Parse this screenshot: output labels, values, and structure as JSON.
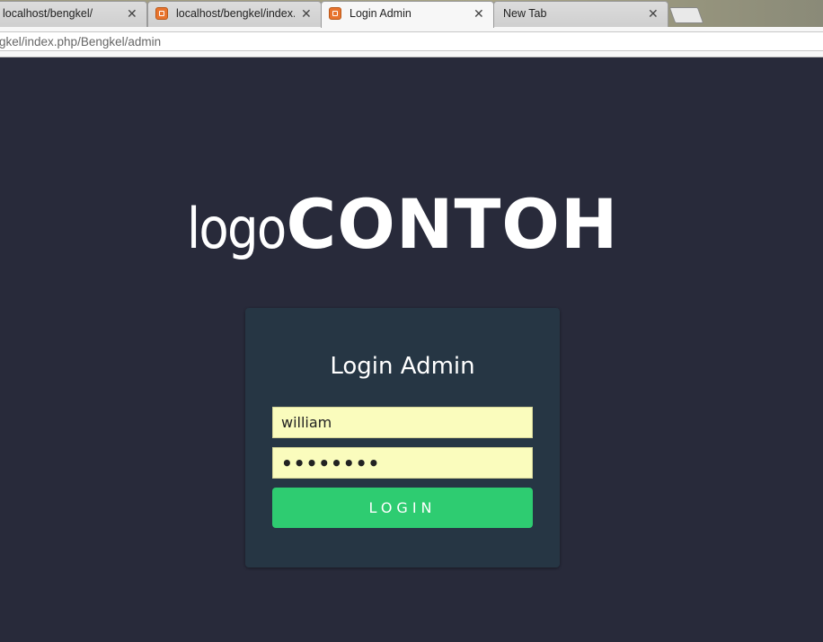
{
  "browser": {
    "tabs": [
      {
        "label": "localhost/bengkel/",
        "has_favicon": false,
        "active": false
      },
      {
        "label": "localhost/bengkel/index.",
        "has_favicon": true,
        "active": false
      },
      {
        "label": "Login Admin",
        "has_favicon": true,
        "active": true
      },
      {
        "label": "New Tab",
        "has_favicon": false,
        "active": false
      }
    ],
    "close_glyph": "✕",
    "address": "gkel/index.php/Bengkel/admin"
  },
  "page": {
    "logo": {
      "light": "logo",
      "bold": "CONTOH"
    },
    "login": {
      "title": "Login Admin",
      "username_value": "william",
      "password_value": "williams",
      "button_label": "LOGIN"
    }
  },
  "colors": {
    "page_bg": "#282a3a",
    "card_bg": "#263644",
    "input_bg": "#fafcbd",
    "button_bg": "#2ecc71"
  }
}
